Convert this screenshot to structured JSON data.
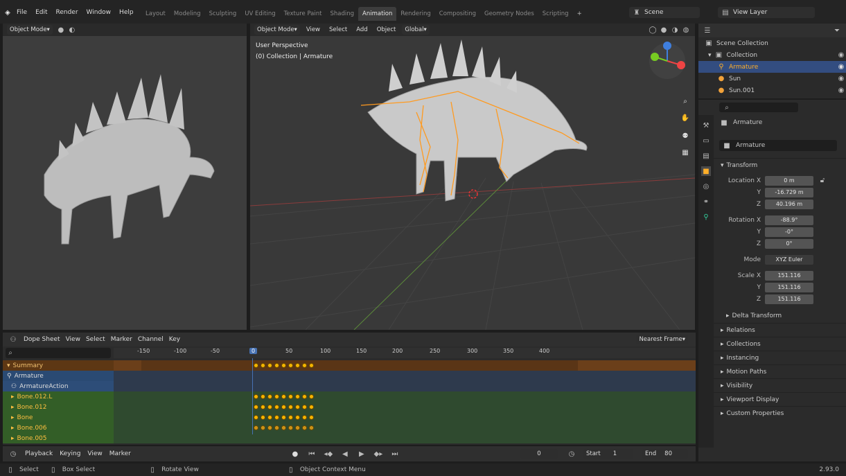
{
  "menu": [
    "File",
    "Edit",
    "Render",
    "Window",
    "Help"
  ],
  "workspace_tabs": [
    "Layout",
    "Modeling",
    "Sculpting",
    "UV Editing",
    "Texture Paint",
    "Shading",
    "Animation",
    "Rendering",
    "Compositing",
    "Geometry Nodes",
    "Scripting"
  ],
  "active_tab": "Animation",
  "scene": "Scene",
  "view_layer": "View Layer",
  "left_view": {
    "mode": "Object Mode"
  },
  "main_view": {
    "mode": "Object Mode",
    "menus": [
      "View",
      "Select",
      "Add",
      "Object"
    ],
    "transform_orient": "Global",
    "overlay_title": "User Perspective",
    "overlay_sub": "(0) Collection | Armature"
  },
  "outliner": {
    "root": "Scene Collection",
    "collection": "Collection",
    "items": [
      "Armature",
      "Sun",
      "Sun.001"
    ]
  },
  "properties": {
    "object_name": "Armature",
    "data_name": "Armature",
    "transform_label": "Transform",
    "location_label": "Location X",
    "location": [
      "0 m",
      "-16.729 m",
      "40.196 m"
    ],
    "rotation_label": "Rotation X",
    "rotation": [
      "-88.9°",
      "-0°",
      "0°"
    ],
    "mode_label": "Mode",
    "mode": "XYZ Euler",
    "scale_label": "Scale X",
    "scale": [
      "151.116",
      "151.116",
      "151.116"
    ],
    "axis_y": "Y",
    "axis_z": "Z",
    "delta": "Delta Transform",
    "sections": [
      "Relations",
      "Collections",
      "Instancing",
      "Motion Paths",
      "Visibility",
      "Viewport Display",
      "Custom Properties"
    ]
  },
  "dopesheet": {
    "editor": "Dope Sheet",
    "menus": [
      "View",
      "Select",
      "Marker",
      "Channel",
      "Key"
    ],
    "snap": "Nearest Frame",
    "ticks": [
      "-150",
      "-100",
      "-50",
      "0",
      "50",
      "100",
      "150",
      "200",
      "250",
      "300",
      "350",
      "400"
    ],
    "current_frame": "0",
    "channels": [
      "Summary",
      "Armature",
      "ArmatureAction",
      "Bone.012.L",
      "Bone.012",
      "Bone",
      "Bone.006",
      "Bone.005"
    ]
  },
  "timeline": {
    "menus": [
      "Playback",
      "Keying",
      "View",
      "Marker"
    ],
    "frame": "0",
    "start_label": "Start",
    "start": "1",
    "end_label": "End",
    "end": "80"
  },
  "status": {
    "select": "Select",
    "box_select": "Box Select",
    "rotate": "Rotate View",
    "context": "Object Context Menu",
    "version": "2.93.0"
  },
  "colors": {
    "accent": "#4772b3",
    "keyframe": "#f5b400",
    "selected": "#ffaf29"
  }
}
